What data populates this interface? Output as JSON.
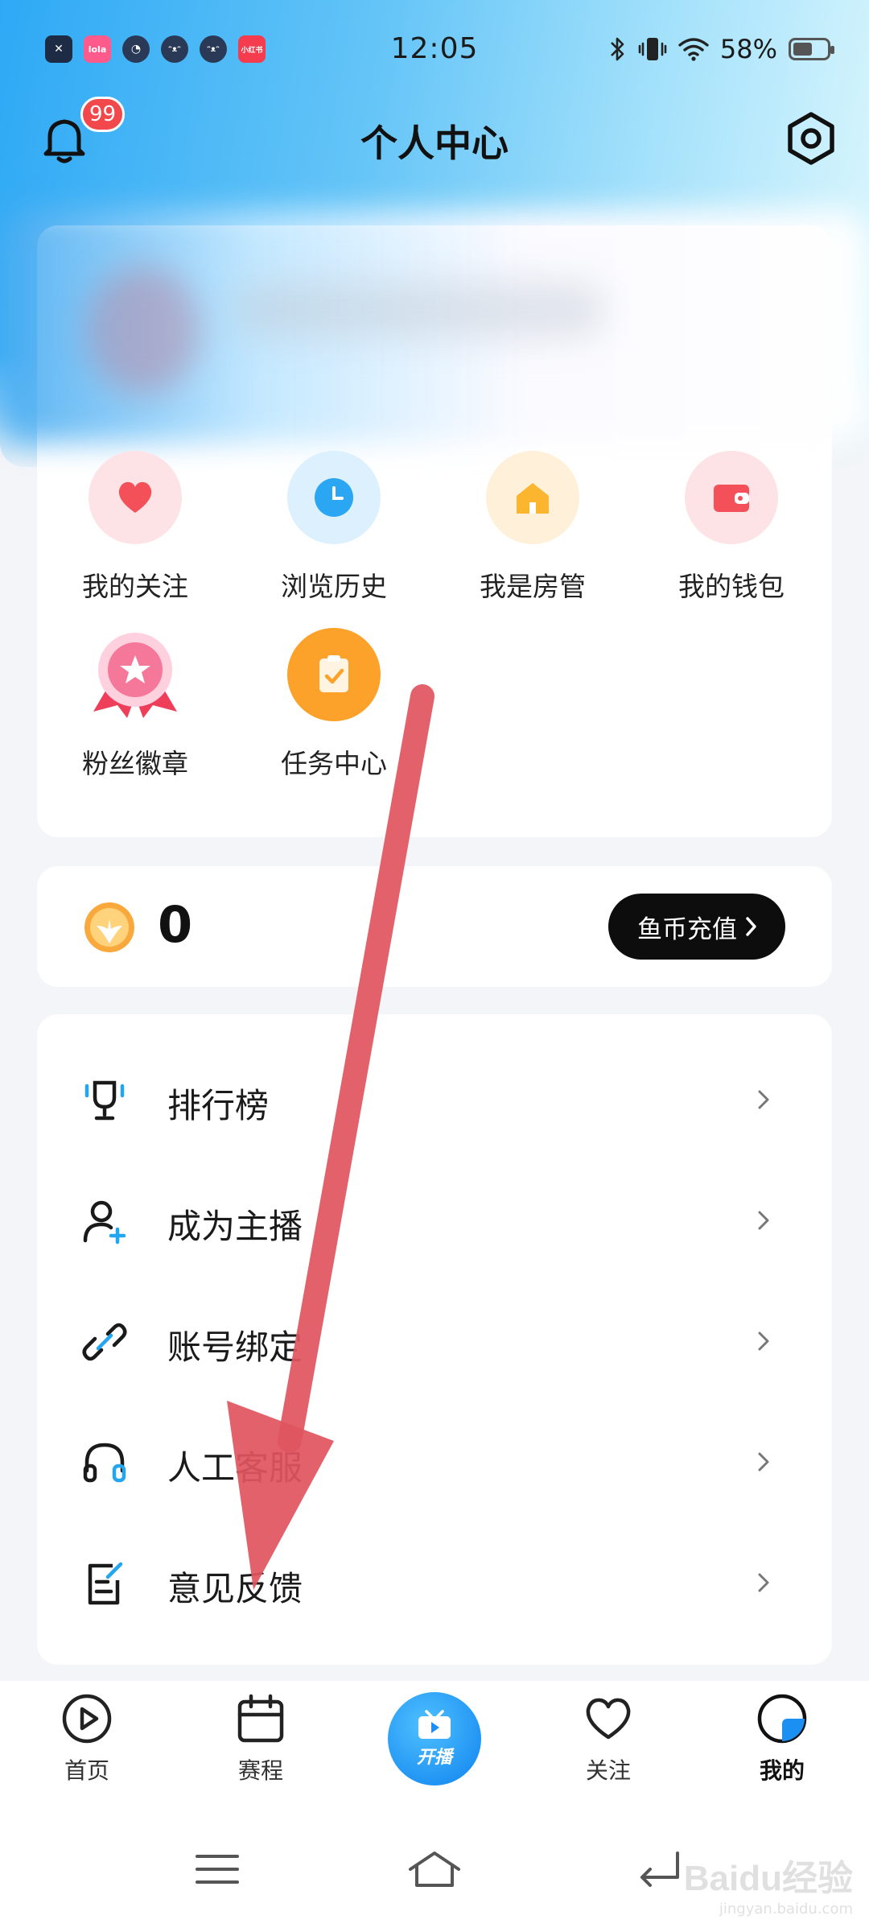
{
  "status_bar": {
    "time": "12:05",
    "battery_percent": "58%",
    "battery_level": 0.58,
    "app_icons": [
      {
        "name": "x-app-icon",
        "glyph": "✕",
        "color": "#1d2b45"
      },
      {
        "name": "lolla-app-icon",
        "glyph": "lola",
        "color": "#ff5a8c"
      },
      {
        "name": "compass-app-icon",
        "glyph": "◔",
        "color": "#2a3a56"
      },
      {
        "name": "cat-app-icon",
        "glyph": "ᵔᴥᵔ",
        "color": "#2a3a56"
      },
      {
        "name": "cat2-app-icon",
        "glyph": "ᵔᴥᵔ",
        "color": "#2a3a56"
      },
      {
        "name": "redbook-app-icon",
        "glyph": "小红书",
        "color": "#f53b4e"
      }
    ]
  },
  "header": {
    "title": "个人中心",
    "notification_badge": "99"
  },
  "quick_actions": [
    {
      "label": "我的关注",
      "icon": "heart-icon",
      "bg": "#fde3e5",
      "fg": "#f3505a"
    },
    {
      "label": "浏览历史",
      "icon": "clock-icon",
      "bg": "#dcf0fd",
      "fg": "#2ba6f3"
    },
    {
      "label": "我是房管",
      "icon": "house-icon",
      "bg": "#fff1d9",
      "fg": "#fbb52e"
    },
    {
      "label": "我的钱包",
      "icon": "wallet-icon",
      "bg": "#fde3e5",
      "fg": "#f3505a"
    },
    {
      "label": "粉丝徽章",
      "icon": "badge-icon",
      "bg": "#ffe1ea",
      "fg": "#f56a8f"
    },
    {
      "label": "任务中心",
      "icon": "task-icon",
      "bg": "#fca12a",
      "fg": "#ffffff"
    }
  ],
  "coins": {
    "value": "0",
    "recharge_label": "鱼币充值"
  },
  "menu": [
    {
      "label": "排行榜",
      "icon": "trophy-icon"
    },
    {
      "label": "成为主播",
      "icon": "add-user-icon"
    },
    {
      "label": "账号绑定",
      "icon": "link-icon"
    },
    {
      "label": "人工客服",
      "icon": "headset-icon"
    },
    {
      "label": "意见反馈",
      "icon": "feedback-icon"
    }
  ],
  "bottom_nav": [
    {
      "label": "首页",
      "icon": "play-circle-icon"
    },
    {
      "label": "赛程",
      "icon": "calendar-icon"
    },
    {
      "label": "开播",
      "icon": "live-tv-icon"
    },
    {
      "label": "关注",
      "icon": "heart-outline-icon"
    },
    {
      "label": "我的",
      "icon": "me-icon"
    }
  ],
  "colors": {
    "accent": "#1b8ff2",
    "badge": "#f2474b",
    "annotation": "#e05560"
  },
  "watermark": {
    "main": "Baidu经验",
    "sub": "jingyan.baidu.com"
  }
}
